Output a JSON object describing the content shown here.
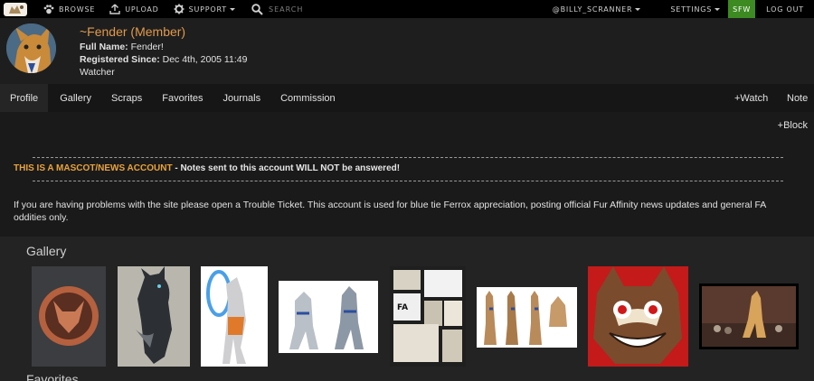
{
  "nav": {
    "browse": "BROWSE",
    "upload": "UPLOAD",
    "support": "SUPPORT",
    "search_placeholder": "SEARCH",
    "user": "@BILLY_SCRANNER",
    "settings": "SETTINGS",
    "sfw": "SFW",
    "logout": "LOG OUT"
  },
  "profile": {
    "username": "~Fender (Member)",
    "fullname_label": "Full Name:",
    "fullname": "Fender!",
    "registered_label": "Registered Since:",
    "registered": "Dec 4th, 2005 11:49",
    "role": "Watcher"
  },
  "tabs": [
    "Profile",
    "Gallery",
    "Scraps",
    "Favorites",
    "Journals",
    "Commission"
  ],
  "actions": {
    "watch": "+Watch",
    "note": "Note",
    "block": "+Block"
  },
  "notice": {
    "highlight": "THIS IS A MASCOT/NEWS ACCOUNT",
    "rest": " - Notes sent to this account WILL NOT be answered!"
  },
  "description": "If you are having problems with the site please open a Trouble Ticket. This account is used for blue tie Ferrox appreciation, posting official Fur Affinity news updates and general FA oddities only.",
  "sections": {
    "gallery": "Gallery",
    "favorites": "Favorites"
  },
  "colors": {
    "accent": "#e09a4c",
    "sfw": "#3c8a21",
    "notice": "#e8a33b"
  }
}
